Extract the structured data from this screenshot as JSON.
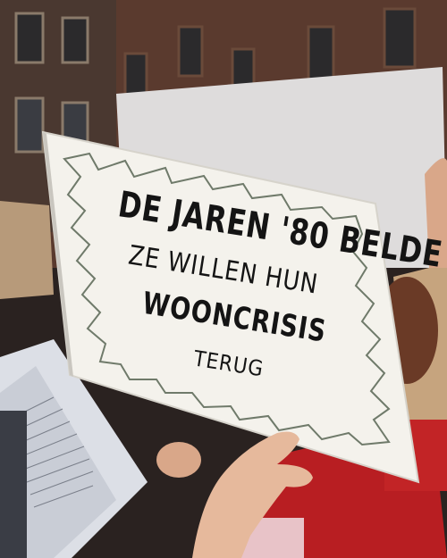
{
  "sign": {
    "line1": "DE JAREN '80 BELDE",
    "line2": "ZE WILLEN HUN",
    "line3": "WOONCRISIS",
    "line4": "TERUG"
  },
  "colors": {
    "sign_paper": "#f4f2ec",
    "sign_ink": "#141414",
    "sign_border_sketch": "#6f7a6a",
    "brick_building": "#5a3a2e",
    "red_jacket": "#b81e22"
  }
}
